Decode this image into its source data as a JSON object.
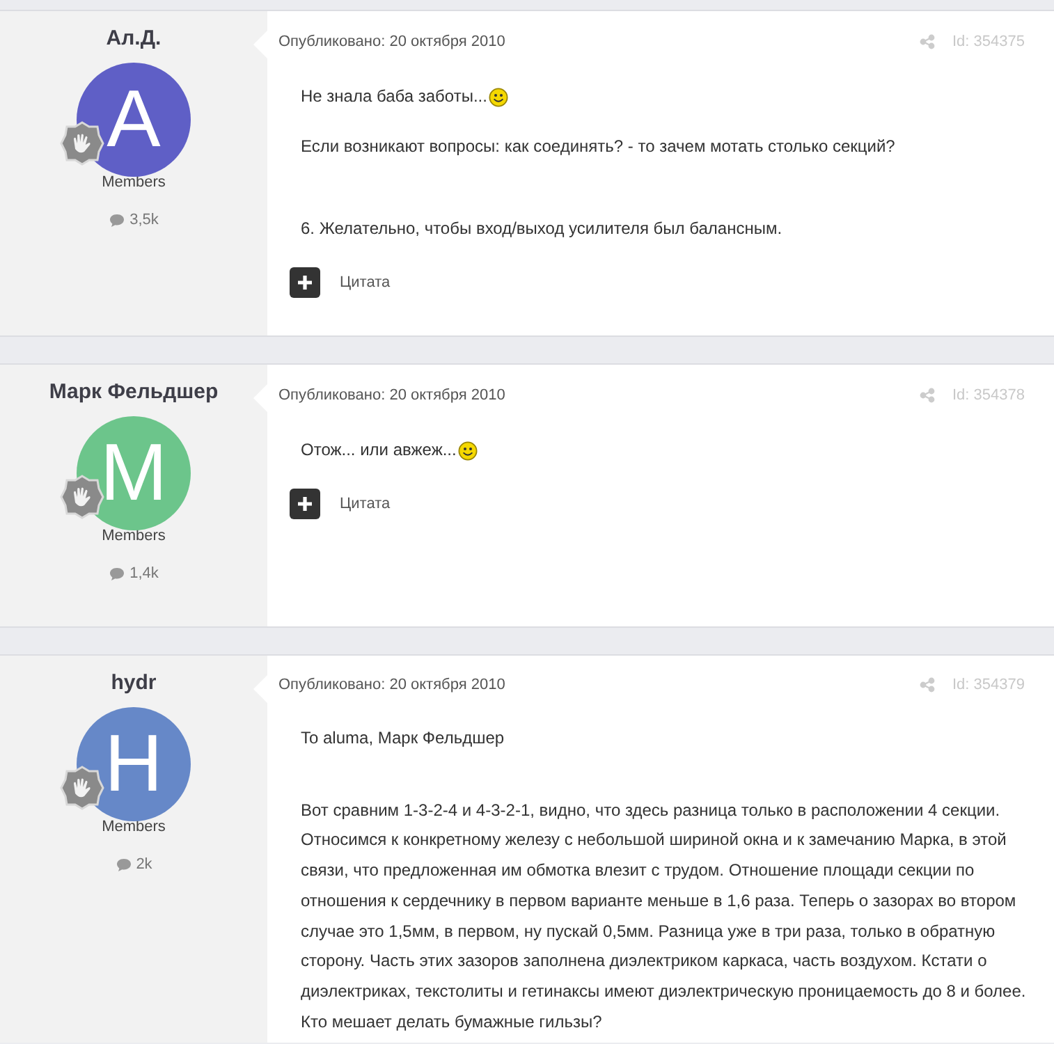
{
  "posts": [
    {
      "author": "Ал.Д.",
      "avatar": {
        "letter": "А",
        "color": "#5f5fc6"
      },
      "group": "Members",
      "post_count": "3,5k",
      "posted": "Опубликовано: 20 октября 2010",
      "post_id": "Id: 354375",
      "paragraphs": [
        {
          "kind": "text",
          "text": "Не знала баба заботы...",
          "smiley": true
        },
        {
          "kind": "text",
          "text": "Если возникают вопросы: как соединять? - то зачем мотать столько секций?",
          "smiley": false
        },
        {
          "kind": "blank"
        },
        {
          "kind": "text",
          "text": "6. Желательно, чтобы вход/выход усилителя был балансным.",
          "smiley": false
        }
      ],
      "quote_label": "Цитата"
    },
    {
      "author": "Марк Фельдшер",
      "avatar": {
        "letter": "М",
        "color": "#6cc58b"
      },
      "group": "Members",
      "post_count": "1,4k",
      "posted": "Опубликовано: 20 октября 2010",
      "post_id": "Id: 354378",
      "paragraphs": [
        {
          "kind": "text",
          "text": "Отож... или авжеж...",
          "smiley": true
        }
      ],
      "quote_label": "Цитата"
    },
    {
      "author": "hydr",
      "avatar": {
        "letter": "H",
        "color": "#6688c8"
      },
      "group": "Members",
      "post_count": "2k",
      "posted": "Опубликовано: 20 октября 2010",
      "post_id": "Id: 354379",
      "paragraphs": [
        {
          "kind": "text",
          "text": "To aluma, Марк Фельдшер",
          "smiley": false
        },
        {
          "kind": "blank"
        },
        {
          "kind": "text",
          "text": "Вот сравним 1-3-2-4 и 4-3-2-1, видно, что здесь разница только в расположении 4 секции. Относимся к конкретному железу с небольшой шириной окна и к замечанию Марка, в этой связи, что предложенная им обмотка влезит с трудом. Отношение площади секции по отношения к сердечнику в первом варианте меньше в 1,6 раза. Теперь о зазорах во втором случае это 1,5мм, в первом, ну пускай 0,5мм. Разница уже в три раза, только в обратную сторону. Часть этих зазоров заполнена диэлектриком каркаса, часть воздухом. Кстати о диэлектриках, текстолиты и гетинаксы имеют диэлектрическую проницаемость до 8 и более. Кто мешает делать бумажные гильзы?",
          "smiley": false
        }
      ]
    }
  ]
}
